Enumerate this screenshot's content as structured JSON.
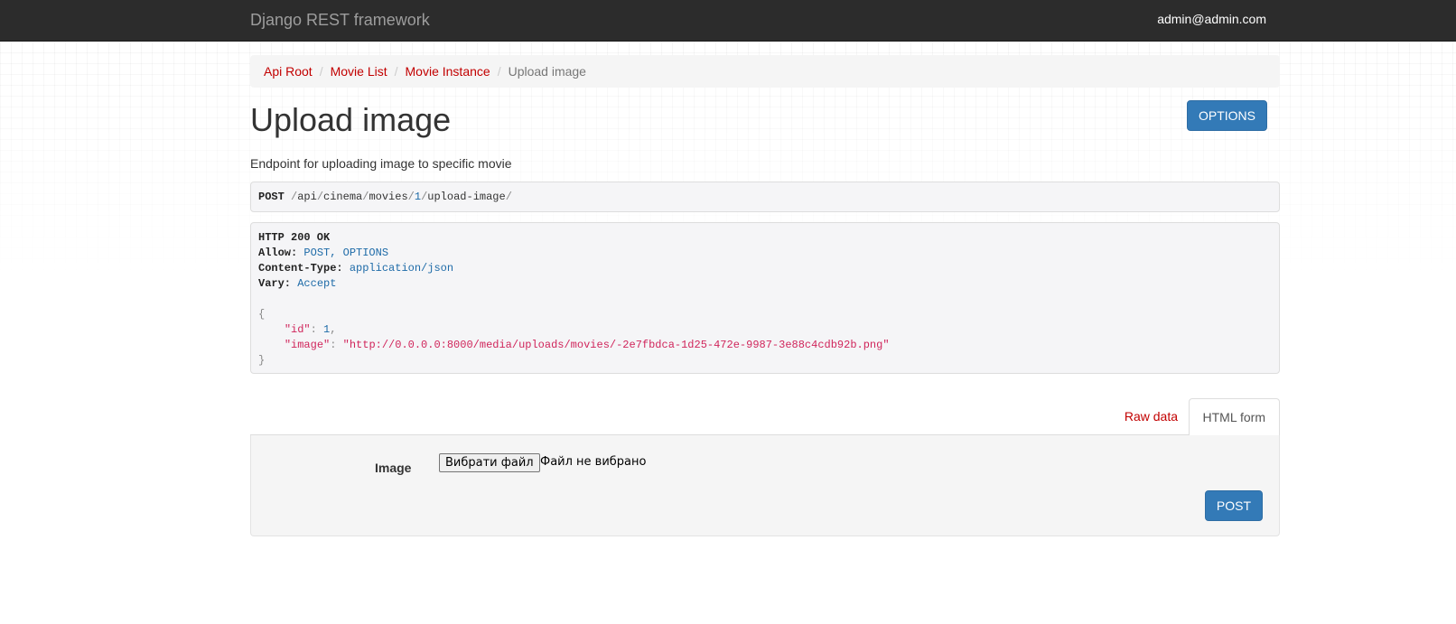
{
  "navbar": {
    "brand": "Django REST framework",
    "user": "admin@admin.com"
  },
  "breadcrumb": {
    "items": [
      "Api Root",
      "Movie List",
      "Movie Instance"
    ],
    "active": "Upload image"
  },
  "page": {
    "title": "Upload image",
    "options_label": "OPTIONS",
    "description": "Endpoint for uploading image to specific movie"
  },
  "request": {
    "method": "POST",
    "path_parts": [
      "api",
      "cinema",
      "movies",
      "1",
      "upload-image"
    ]
  },
  "response": {
    "status": "HTTP 200 OK",
    "headers": [
      {
        "name": "Allow:",
        "value": "POST, OPTIONS"
      },
      {
        "name": "Content-Type:",
        "value": "application/json"
      },
      {
        "name": "Vary:",
        "value": "Accept"
      }
    ],
    "body": {
      "id_key": "\"id\"",
      "id_value": "1",
      "image_key": "\"image\"",
      "image_value": "\"http://0.0.0.0:8000/media/uploads/movies/-2e7fbdca-1d25-472e-9987-3e88c4cdb92b.png\""
    }
  },
  "tabs": {
    "raw": "Raw data",
    "html": "HTML form"
  },
  "form": {
    "field_label": "Image",
    "file_button": "Вибрати файл",
    "file_status": "Файл не вибрано",
    "submit_label": "POST"
  },
  "colors": {
    "navbar_bg": "#2c2c2c",
    "link": "#c20000",
    "primary": "#337ab7",
    "string": "#d0255b",
    "literal": "#1e6ba8"
  }
}
